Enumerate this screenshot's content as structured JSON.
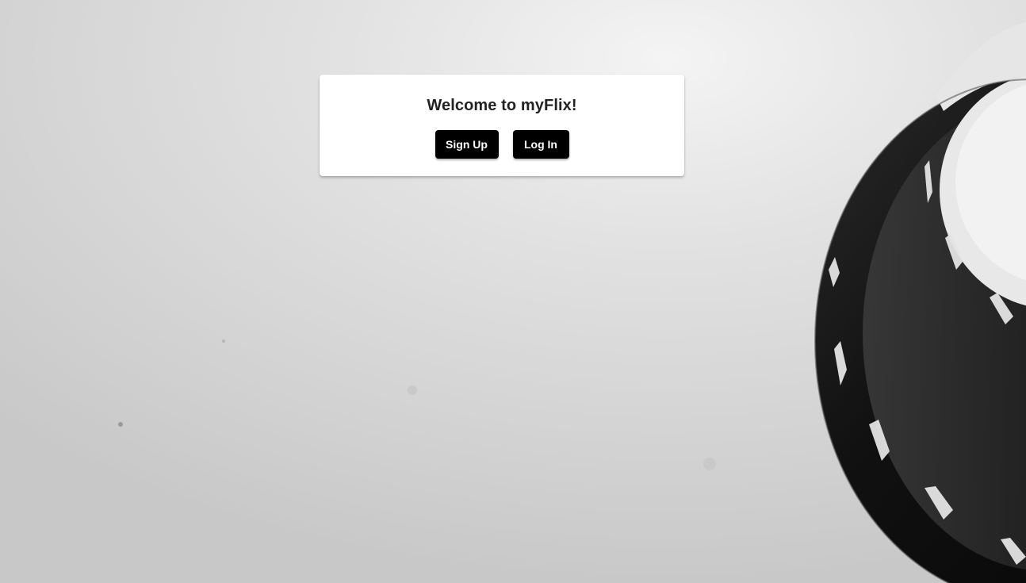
{
  "welcome": {
    "title": "Welcome to myFlix!",
    "signup_label": "Sign Up",
    "login_label": "Log In"
  },
  "background": {
    "image": "film-reel-photo",
    "tone": "grayscale"
  }
}
